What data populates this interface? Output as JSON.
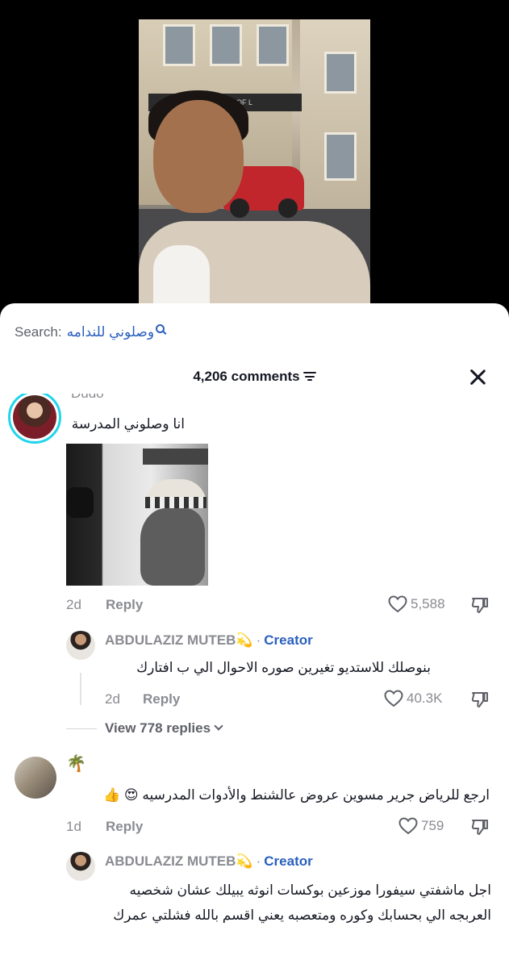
{
  "search": {
    "label": "Search:",
    "query": "وصلوني للندامه",
    "icon": "search-icon"
  },
  "header": {
    "comments_count": "4,206 comments",
    "sort_icon": "sort-icon",
    "close_icon": "close-icon"
  },
  "video": {
    "sign_text": "THE DUKE OF L"
  },
  "comments": [
    {
      "username": "Dudo",
      "text": "انا وصلوني المدرسة",
      "has_image": true,
      "time": "2d",
      "reply_label": "Reply",
      "likes": "5,588",
      "replies": [
        {
          "username": "ABDULAZIZ MUTEB💫",
          "badge": "Creator",
          "text": "بنوصلك للاستديو تغيرين صوره الاحوال الي ب افتارك",
          "time": "2d",
          "reply_label": "Reply",
          "likes": "40.3K"
        }
      ],
      "view_replies": "View 778 replies"
    },
    {
      "username": "🌴",
      "text": "ارجع للرياض جرير مسوين عروض عالشنط والأدوات المدرسيه 😍 👍",
      "time": "1d",
      "reply_label": "Reply",
      "likes": "759",
      "replies": [
        {
          "username": "ABDULAZIZ MUTEB💫",
          "badge": "Creator",
          "text": "اجل ماشفتي سيفورا موزعين بوكسات انوثه يبيلك عشان شخصيه العربجه الي بحسابك وكوره ومتعصبه يعني اقسم بالله فشلتي عمرك"
        }
      ]
    }
  ],
  "colors": {
    "creator": "#2a5fbf",
    "muted": "#8a8b91",
    "text": "#161823",
    "ring": "#20d5ec"
  }
}
